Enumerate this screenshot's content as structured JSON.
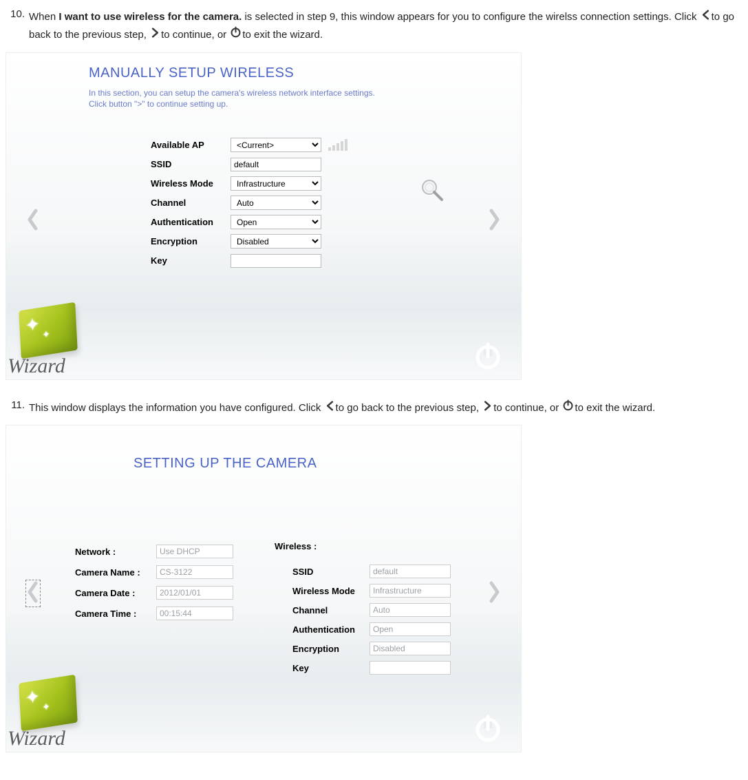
{
  "step10": {
    "num": "10.",
    "text_pre": "When ",
    "bold": "I want to use wireless for the camera.",
    "text_post1": " is selected in step 9, this window appears for you to configure the wirelss connection settings. Click ",
    "text_post2": "to go back to the previous step, ",
    "text_post3": "to continue, or ",
    "text_post4": "to exit the wizard."
  },
  "step11": {
    "num": "11.",
    "text1": "This window displays the information you have configured. Click ",
    "text2": "to go back to the previous step, ",
    "text3": "to continue, or ",
    "text4": "to exit the wizard."
  },
  "logo_text": "Wizard",
  "wiz1": {
    "title": "MANUALLY SETUP WIRELESS",
    "desc": "In this section, you can setup the camera's wireless network interface settings. Click button \">\" to continue setting up.",
    "labels": {
      "available_ap": "Available AP",
      "ssid": "SSID",
      "wireless_mode": "Wireless Mode",
      "channel": "Channel",
      "authentication": "Authentication",
      "encryption": "Encryption",
      "key": "Key"
    },
    "values": {
      "available_ap": "<Current>",
      "ssid": "default",
      "wireless_mode": "Infrastructure",
      "channel": "Auto",
      "authentication": "Open",
      "encryption": "Disabled",
      "key": ""
    }
  },
  "wiz2": {
    "title": "SETTING UP THE CAMERA",
    "left": {
      "network_lbl": "Network :",
      "camera_name_lbl": "Camera Name :",
      "camera_date_lbl": "Camera Date :",
      "camera_time_lbl": "Camera Time :",
      "network": "Use DHCP",
      "camera_name": "CS-3122",
      "camera_date": "2012/01/01",
      "camera_time": "00:15:44"
    },
    "right": {
      "hdr": "Wireless :",
      "ssid_lbl": "SSID",
      "wireless_mode_lbl": "Wireless Mode",
      "channel_lbl": "Channel",
      "authentication_lbl": "Authentication",
      "encryption_lbl": "Encryption",
      "key_lbl": "Key",
      "ssid": "default",
      "wireless_mode": "Infrastructure",
      "channel": "Auto",
      "authentication": "Open",
      "encryption": "Disabled",
      "key": ""
    }
  }
}
